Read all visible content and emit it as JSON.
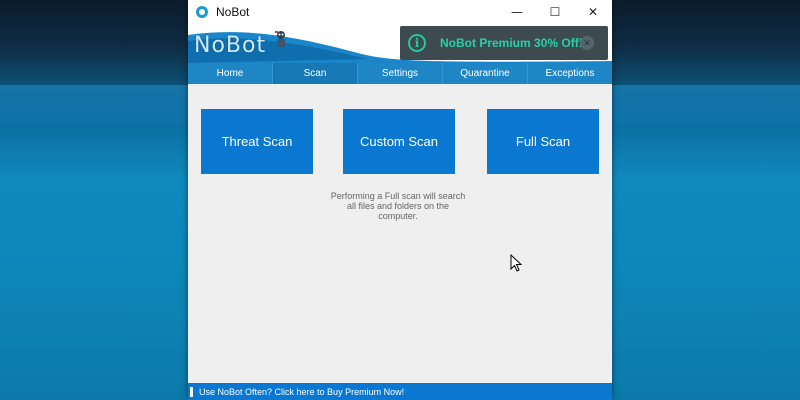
{
  "window": {
    "title": "NoBot"
  },
  "window_controls": {
    "minimize": "—",
    "maximize": "☐",
    "close": "✕"
  },
  "header": {
    "logo_text": "NoBot",
    "promo": {
      "text": "NoBot Premium 30% Off!",
      "info_glyph": "i",
      "close_glyph": "✕"
    }
  },
  "nav": {
    "items": [
      {
        "label": "Home"
      },
      {
        "label": "Scan"
      },
      {
        "label": "Settings"
      },
      {
        "label": "Quarantine"
      },
      {
        "label": "Exceptions"
      }
    ],
    "active": "Scan"
  },
  "scan": {
    "buttons": [
      {
        "label": "Threat Scan"
      },
      {
        "label": "Custom Scan"
      },
      {
        "label": "Full Scan"
      }
    ],
    "description": "Performing a Full scan will search all files and folders on the computer."
  },
  "footer": {
    "text": "Use NoBot Often? Click here to Buy Premium Now!"
  },
  "colors": {
    "accent": "#0a78d0",
    "nav": "#1e86c5",
    "promo_bg": "#3d4a4f",
    "promo_text": "#27d1a8"
  },
  "icons": {
    "app": "nobot-app-icon",
    "promo_info": "info-icon",
    "promo_close": "close-icon",
    "cursor": "mouse-pointer-icon"
  }
}
